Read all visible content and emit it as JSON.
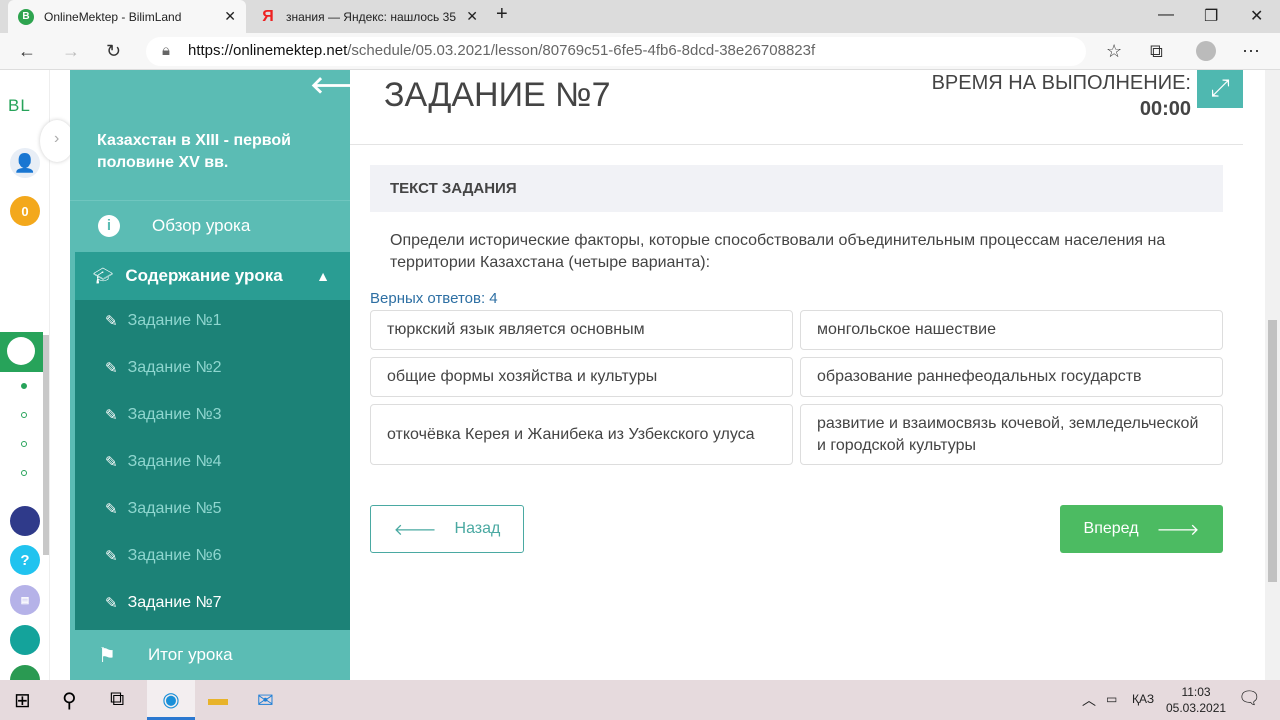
{
  "browser": {
    "tabs": [
      {
        "title": "OnlineMektep - BilimLand",
        "icon": "bilimland-icon"
      },
      {
        "title": "знания — Яндекс: нашлось 35",
        "icon": "yandex-icon"
      }
    ],
    "url_host": "https://onlinemektep.net",
    "url_path": "/schedule/05.03.2021/lesson/80769c51-6fe5-4fb6-8dcd-38e26708823f"
  },
  "rail": {
    "logo": "BL",
    "points": "0"
  },
  "sidebar": {
    "lesson_title": "Казахстан в XIII - первой половине XV вв.",
    "overview": "Обзор урока",
    "content": "Содержание урока",
    "tasks": [
      "Задание №1",
      "Задание №2",
      "Задание №3",
      "Задание №4",
      "Задание №5",
      "Задание №6",
      "Задание №7"
    ],
    "result": "Итог урока"
  },
  "main": {
    "title": "ЗАДАНИЕ №7",
    "timer_label": "ВРЕМЯ НА ВЫПОЛНЕНИЕ:",
    "timer_value": "00:00",
    "task_header": "ТЕКСТ ЗАДАНИЯ",
    "question": "Определи исторические факторы, которые способствовали объединительным процессам населения на территории Казахстана (четыре варианта):",
    "correct_count": "Верных ответов: 4",
    "options": [
      "тюркский язык является основным",
      "монгольское нашествие",
      "общие формы хозяйства и культуры",
      "образование раннефеодальных государств",
      "откочёвка Керея и Жанибека из Узбекского улуса",
      "развитие и взаимосвязь кочевой, земледельческой и городской культуры"
    ],
    "back": "Назад",
    "next": "Вперед"
  },
  "taskbar": {
    "lang": "ҚАЗ",
    "time": "11:03",
    "date": "05.03.2021"
  },
  "colors": {
    "teal": "#5bbcb4",
    "teal_dark": "#1c8277",
    "green": "#4cbb62"
  }
}
